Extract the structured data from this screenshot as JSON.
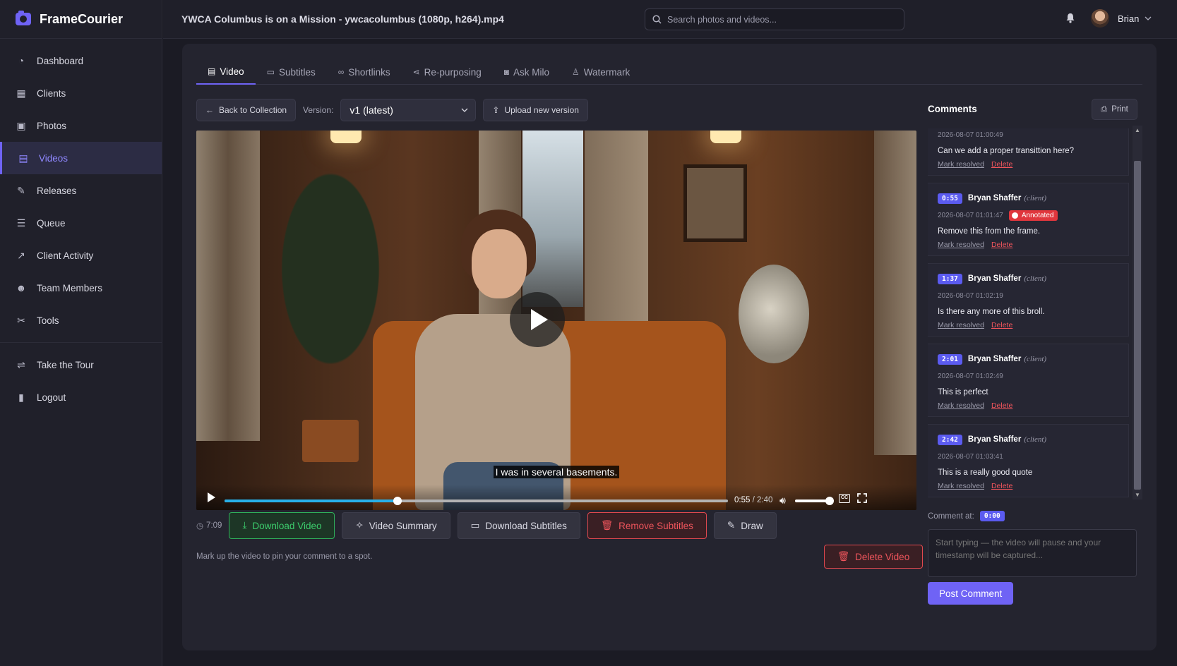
{
  "brand": {
    "name": "FrameCourier"
  },
  "header": {
    "file_title": "YWCA Columbus is on a Mission - ywcacolumbus (1080p, h264).mp4",
    "search_placeholder": "Search photos and videos...",
    "user_name": "Brian"
  },
  "sidebar": {
    "items": [
      {
        "label": "Dashboard",
        "icon": "dashboard-icon"
      },
      {
        "label": "Clients",
        "icon": "building-icon"
      },
      {
        "label": "Photos",
        "icon": "photos-icon"
      },
      {
        "label": "Videos",
        "icon": "film-icon",
        "active": true
      },
      {
        "label": "Releases",
        "icon": "signature-icon"
      },
      {
        "label": "Queue",
        "icon": "list-icon"
      },
      {
        "label": "Client Activity",
        "icon": "chart-line-icon"
      },
      {
        "label": "Team Members",
        "icon": "users-icon"
      },
      {
        "label": "Tools",
        "icon": "tools-icon"
      }
    ],
    "bottom_items": [
      {
        "label": "Take the Tour",
        "icon": "signpost-icon"
      },
      {
        "label": "Logout",
        "icon": "door-icon"
      }
    ]
  },
  "tabs": [
    {
      "label": "Video",
      "icon": "film-icon",
      "active": true
    },
    {
      "label": "Subtitles",
      "icon": "cc-icon"
    },
    {
      "label": "Shortlinks",
      "icon": "link-icon"
    },
    {
      "label": "Re-purposing",
      "icon": "share-icon"
    },
    {
      "label": "Ask Milo",
      "icon": "chat-icon"
    },
    {
      "label": "Watermark",
      "icon": "stamp-icon"
    }
  ],
  "toolbar": {
    "back_label": "Back to Collection",
    "version_label": "Version:",
    "version_value": "v1 (latest)",
    "upload_label": "Upload new version"
  },
  "player": {
    "subtitle": "I was in several basements.",
    "current_time": "0:55",
    "duration": "2:40",
    "progress": 0.344,
    "volume": 0.9
  },
  "actions": {
    "runtime": "7:09",
    "download_video": "Download Video",
    "video_summary": "Video Summary",
    "download_subtitles": "Download Subtitles",
    "remove_subtitles": "Remove Subtitles",
    "draw": "Draw",
    "delete_video": "Delete Video",
    "hint": "Mark up the video to pin your comment to a spot."
  },
  "comments": {
    "title": "Comments",
    "print_label": "Print",
    "mark_resolved": "Mark resolved",
    "delete": "Delete",
    "items": [
      {
        "timestamp": "",
        "author": "",
        "role": "",
        "date": "2026-08-07 01:00:49",
        "annotated": false,
        "text": "Can we add a proper transittion here?"
      },
      {
        "timestamp": "0:55",
        "author": "Bryan Shaffer",
        "role": "(client)",
        "date": "2026-08-07 01:01:47",
        "annotated": true,
        "text": "Remove this from the frame."
      },
      {
        "timestamp": "1:37",
        "author": "Bryan Shaffer",
        "role": "(client)",
        "date": "2026-08-07 01:02:19",
        "annotated": false,
        "text": "Is there any more of this broll."
      },
      {
        "timestamp": "2:01",
        "author": "Bryan Shaffer",
        "role": "(client)",
        "date": "2026-08-07 01:02:49",
        "annotated": false,
        "text": "This is perfect"
      },
      {
        "timestamp": "2:42",
        "author": "Bryan Shaffer",
        "role": "(client)",
        "date": "2026-08-07 01:03:41",
        "annotated": false,
        "text": "This is a really good quote"
      }
    ],
    "annotated_label": "Annotated",
    "comment_at_label": "Comment at:",
    "comment_at_value": "0:00",
    "input_placeholder": "Start typing — the video will pause and your timestamp will be captured...",
    "post_label": "Post Comment"
  },
  "colors": {
    "accent": "#6f63f5",
    "success": "#3ccc6c",
    "danger": "#f0555c",
    "progress": "#28b0e8"
  }
}
